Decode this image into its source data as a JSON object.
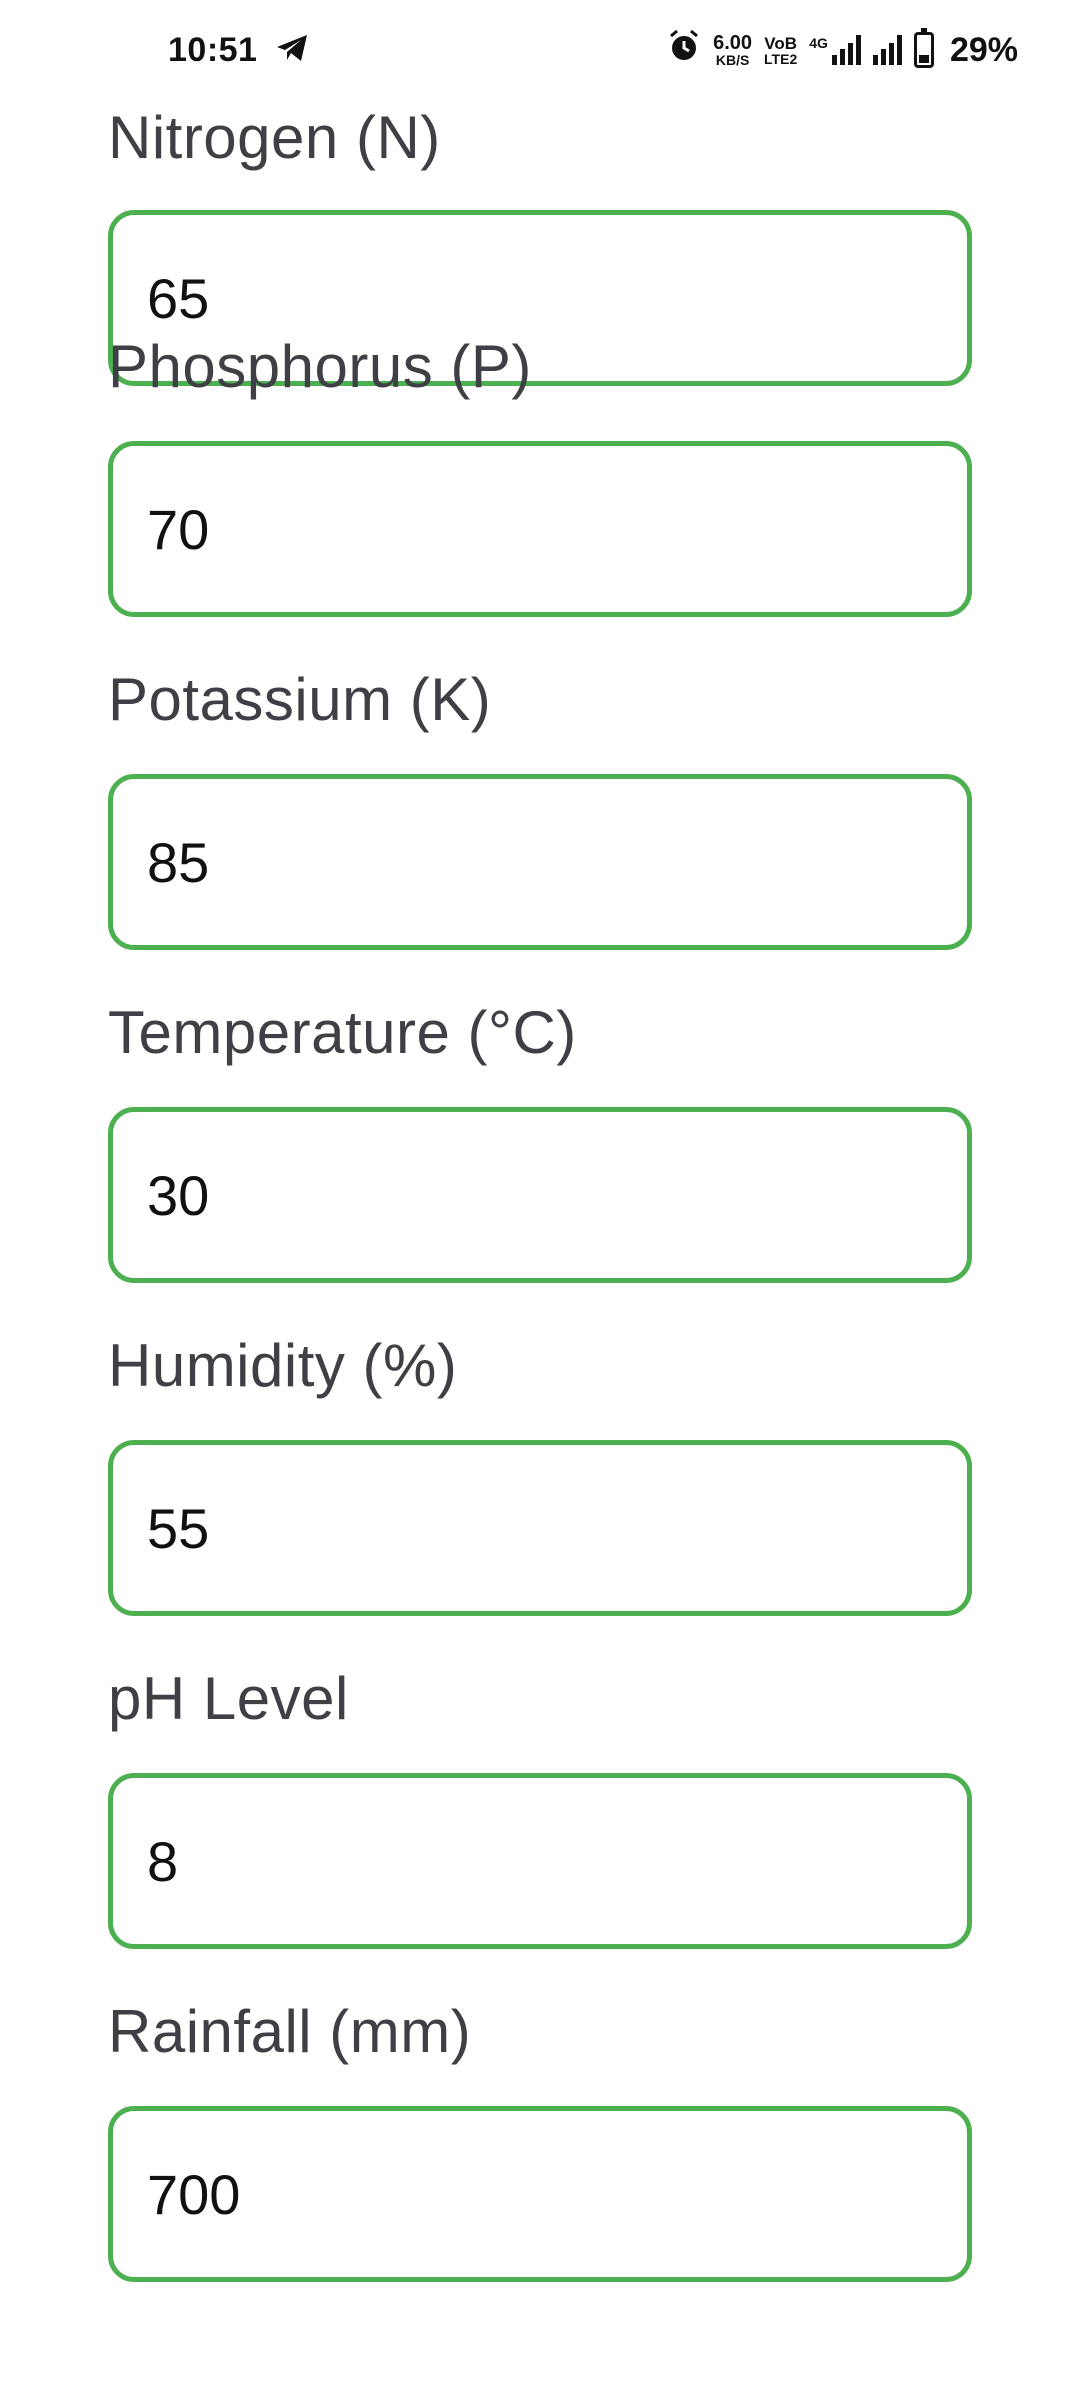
{
  "status_bar": {
    "time": "10:51",
    "net_speed_value": "6.00",
    "net_speed_unit": "KB/S",
    "volte_top": "VoB",
    "volte_bottom": "LTE2",
    "network_type": "4G",
    "battery_percent": "29%"
  },
  "form": {
    "fields": [
      {
        "label": "Nitrogen (N)",
        "value": "65"
      },
      {
        "label": "Phosphorus (P)",
        "value": "70"
      },
      {
        "label": "Potassium (K)",
        "value": "85"
      },
      {
        "label": "Temperature (°C)",
        "value": "30"
      },
      {
        "label": "Humidity (%)",
        "value": "55"
      },
      {
        "label": "pH Level",
        "value": "8"
      },
      {
        "label": "Rainfall (mm)",
        "value": "700"
      }
    ]
  },
  "colors": {
    "input_border": "#4caf50",
    "label_text": "#3f3f46",
    "value_text": "#111111"
  }
}
